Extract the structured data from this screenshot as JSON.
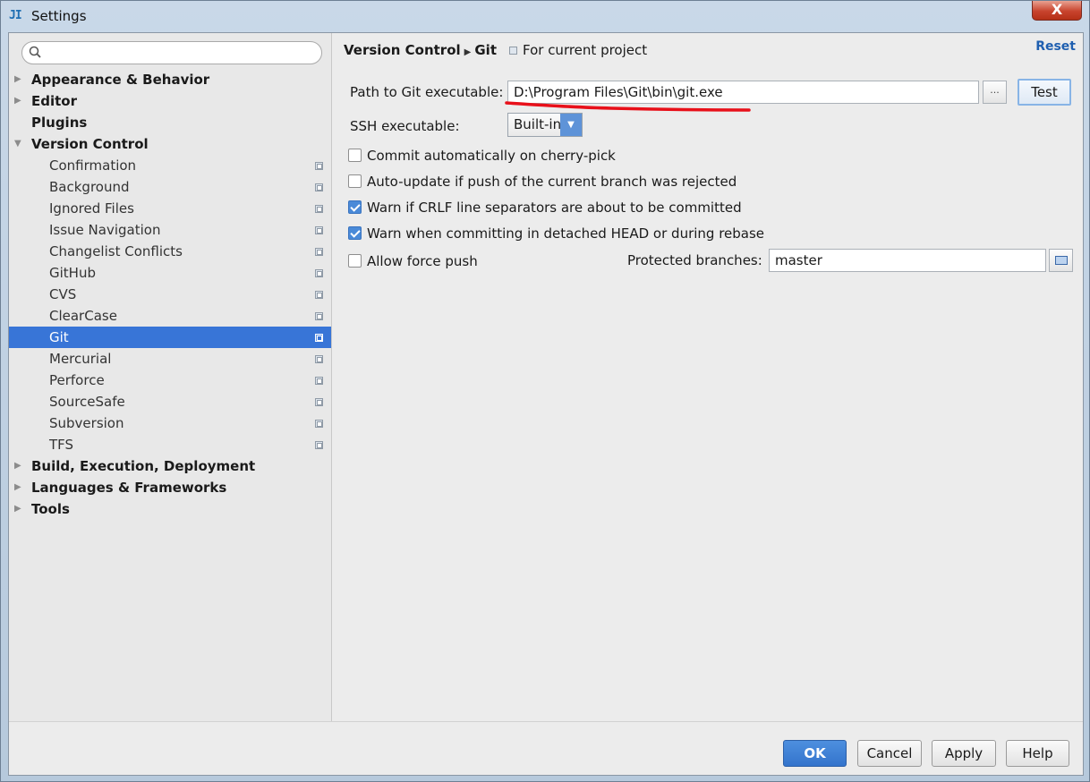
{
  "window": {
    "app_icon": "IntelliJ IDEA icon",
    "icon_text": "JI",
    "title": "Settings",
    "close_label": "X"
  },
  "sidebar": {
    "search_placeholder": "",
    "items": [
      {
        "label": "Appearance & Behavior",
        "level": 0,
        "arrow": "▶"
      },
      {
        "label": "Editor",
        "level": 0,
        "arrow": "▶"
      },
      {
        "label": "Plugins",
        "level": 0,
        "arrow": ""
      },
      {
        "label": "Version Control",
        "level": 0,
        "arrow": "▼"
      },
      {
        "label": "Confirmation",
        "level": 1
      },
      {
        "label": "Background",
        "level": 1
      },
      {
        "label": "Ignored Files",
        "level": 1
      },
      {
        "label": "Issue Navigation",
        "level": 1
      },
      {
        "label": "Changelist Conflicts",
        "level": 1
      },
      {
        "label": "GitHub",
        "level": 1
      },
      {
        "label": "CVS",
        "level": 1
      },
      {
        "label": "ClearCase",
        "level": 1
      },
      {
        "label": "Git",
        "level": 1,
        "selected": true
      },
      {
        "label": "Mercurial",
        "level": 1
      },
      {
        "label": "Perforce",
        "level": 1
      },
      {
        "label": "SourceSafe",
        "level": 1
      },
      {
        "label": "Subversion",
        "level": 1
      },
      {
        "label": "TFS",
        "level": 1
      },
      {
        "label": "Build, Execution, Deployment",
        "level": 0,
        "arrow": "▶"
      },
      {
        "label": "Languages & Frameworks",
        "level": 0,
        "arrow": "▶"
      },
      {
        "label": "Tools",
        "level": 0,
        "arrow": "▶"
      }
    ]
  },
  "content": {
    "breadcrumb": {
      "parent": "Version Control",
      "current": "Git",
      "scope": "For current project"
    },
    "reset_label": "Reset",
    "path_label": "Path to Git executable:",
    "path_value": "D:\\Program Files\\Git\\bin\\git.exe",
    "browse_label": "...",
    "test_label": "Test",
    "ssh_label": "SSH executable:",
    "ssh_value": "Built-in",
    "options": [
      {
        "label": "Commit automatically on cherry-pick",
        "checked": false
      },
      {
        "label": "Auto-update if push of the current branch was rejected",
        "checked": false
      },
      {
        "label": "Warn if CRLF line separators are about to be committed",
        "checked": true
      },
      {
        "label": "Warn when committing in detached HEAD or during rebase",
        "checked": true
      },
      {
        "label": "Allow force push",
        "checked": false
      }
    ],
    "protected_label": "Protected branches:",
    "protected_value": "master",
    "annotation_color": "#e8101a"
  },
  "footer": {
    "ok": "OK",
    "cancel": "Cancel",
    "apply": "Apply",
    "help": "Help"
  },
  "colors": {
    "selection": "#3875d7",
    "primary_button": "#3474cc",
    "link": "#1f5fb0"
  }
}
